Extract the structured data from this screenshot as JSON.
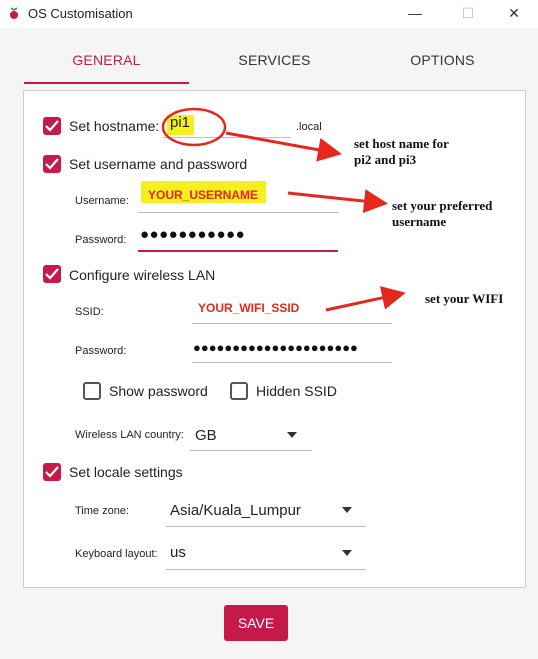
{
  "window": {
    "title": "OS Customisation",
    "minimize": "—",
    "maximize": "☐",
    "close": "✕"
  },
  "tabs": [
    {
      "label": "GENERAL"
    },
    {
      "label": "SERVICES"
    },
    {
      "label": "OPTIONS"
    }
  ],
  "general": {
    "hostname": {
      "label": "Set hostname:",
      "value": "pi1",
      "suffix": ".local",
      "checked": true
    },
    "user": {
      "label": "Set username and password",
      "checked": true,
      "username_label": "Username:",
      "username_value": "YOUR_USERNAME",
      "password_label": "Password:",
      "password_value": "●●●●●●●●●●●"
    },
    "wifi": {
      "label": "Configure wireless LAN",
      "checked": true,
      "ssid_label": "SSID:",
      "ssid_value": "YOUR_WIFI_SSID",
      "password_label": "Password:",
      "password_value": "●●●●●●●●●●●●●●●●●●●●●",
      "show_password": "Show password",
      "hidden_ssid": "Hidden SSID",
      "country_label": "Wireless LAN country:",
      "country_value": "GB"
    },
    "locale": {
      "label": "Set locale settings",
      "checked": true,
      "timezone_label": "Time zone:",
      "timezone_value": "Asia/Kuala_Lumpur",
      "keyboard_label": "Keyboard layout:",
      "keyboard_value": "us"
    }
  },
  "save_label": "SAVE",
  "annotations": {
    "hostname_note_line1": "set host name for",
    "hostname_note_line2": "pi2 and pi3",
    "username_note_line1": "set your preferred",
    "username_note_line2": "username",
    "wifi_note": "set your WIFI"
  },
  "colors": {
    "accent": "#c51a4a",
    "annotation_red": "#e5281e",
    "highlight": "#f4ef1e"
  }
}
